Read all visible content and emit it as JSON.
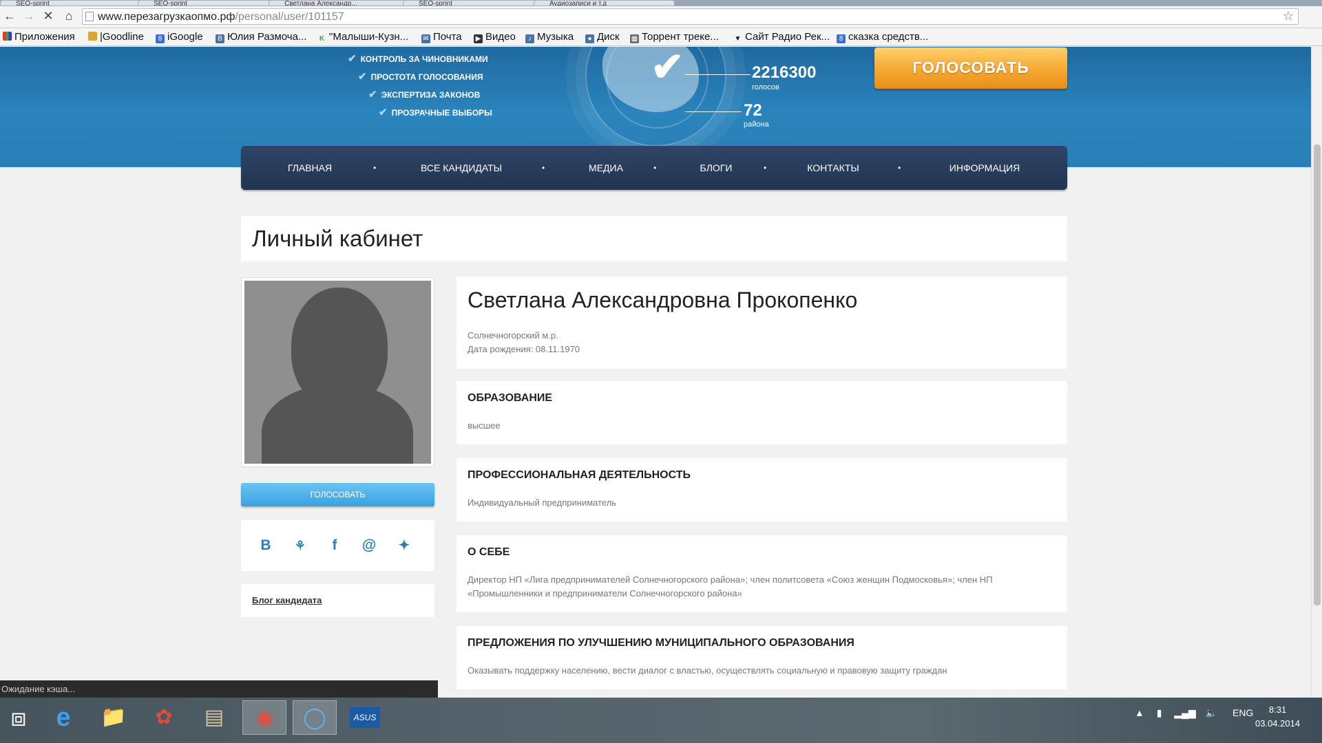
{
  "browser": {
    "tabs": [
      "SEO-sprint",
      "SEO-sprint",
      "Светлана Александр...",
      "SEO-sprint",
      "Аудиозаписи и т.д"
    ],
    "url_host": "www.перезагрузкаопмо.рф",
    "url_path": "/personal/user/101157",
    "bookmarks": [
      "Приложения",
      "|Goodline",
      "iGoogle",
      "Юлия Размоча...",
      "\"Малыши-Кузн...",
      "Почта",
      "Видео",
      "Музыка",
      "Диск",
      "Торрент треке...",
      "Сайт Радио Рек...",
      "сказка средств..."
    ],
    "status": "Ожидание кэша..."
  },
  "hero": {
    "checks": [
      "КОНТРОЛЬ ЗА ЧИНОВНИКАМИ",
      "ПРОСТОТА ГОЛОСОВАНИЯ",
      "ЭКСПЕРТИЗА ЗАКОНОВ",
      "ПРОЗРАЧНЫЕ ВЫБОРЫ"
    ],
    "votes_count": "2216300",
    "votes_label": "голосов",
    "districts_count": "72",
    "districts_label": "района",
    "vote_button": "ГОЛОСОВАТЬ"
  },
  "nav": [
    "ГЛАВНАЯ",
    "ВСЕ КАНДИДАТЫ",
    "МЕДИА",
    "БЛОГИ",
    "КОНТАКТЫ",
    "ИНФОРМАЦИЯ"
  ],
  "page": {
    "title": "Личный кабинет",
    "vote_button": "ГОЛОСОВАТЬ",
    "social_labels": [
      "В",
      "ok",
      "f",
      "@",
      "tw"
    ],
    "blog_link": "Блог кандидата"
  },
  "profile": {
    "name": "Светлана Александровна Прокопенко",
    "district": "Солнечногорский м.р.",
    "birth": "Дата рождения: 08.11.1970"
  },
  "sections": [
    {
      "heading": "ОБРАЗОВАНИЕ",
      "text": "высшее"
    },
    {
      "heading": "ПРОФЕССИОНАЛЬНАЯ ДЕЯТЕЛЬНОСТЬ",
      "text": "Индивидуальный предприниматель"
    },
    {
      "heading": "О СЕБЕ",
      "text": "Директор НП «Лига предпринимателей Солнечногорского района»; член политсовета «Союз женщин Подмосковья»; член НП «Промышленники и предприниматели Солнечногорского района»"
    },
    {
      "heading": "ПРЕДЛОЖЕНИЯ ПО УЛУЧШЕНИЮ МУНИЦИПАЛЬНОГО ОБРАЗОВАНИЯ",
      "text": "Оказывать поддержку населению, вести диалог с властью, осуществлять социальную и правовую защиту граждан"
    }
  ],
  "taskbar": {
    "lang": "ENG",
    "time": "8:31",
    "date": "03.04.2014"
  },
  "colors": {
    "accent_blue": "#2a7fb7",
    "nav_bg": "#223552",
    "vote_orange": "#f4a52e"
  }
}
